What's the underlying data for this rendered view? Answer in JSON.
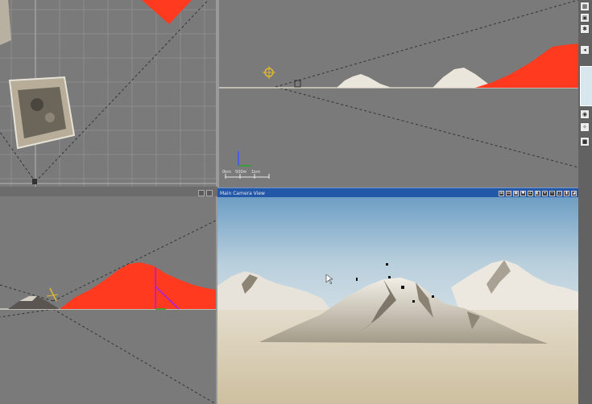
{
  "viewports": {
    "camera": {
      "title": "Main Camera View",
      "header_buttons": [
        "⊞",
        "⊡",
        "▣",
        "✱",
        "Z",
        "◧",
        "+",
        "−",
        "◫",
        "▮",
        "◪"
      ]
    },
    "side": {
      "scale_ticks": [
        "0km",
        "500m",
        "1km"
      ]
    }
  },
  "right_panel": {
    "icons": [
      "grid-icon",
      "render-icon",
      "settings-icon",
      "arrow-icon",
      "camera-icon",
      "light-icon",
      "object-icon"
    ]
  },
  "colors": {
    "accent": "#2357a8",
    "terrain_red": "#ff3a1f",
    "viewport_bg": "#7a7a7a",
    "sky_top": "#6e9ec4",
    "sky_bottom": "#d2dfe6",
    "ground": "#d8ccb0"
  }
}
